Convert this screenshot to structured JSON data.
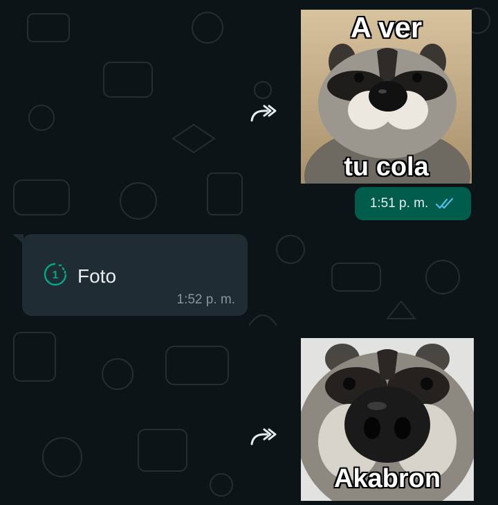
{
  "messages": {
    "sticker1": {
      "top_caption": "A ver",
      "bottom_caption": "tu cola",
      "time": "1:51 p. m."
    },
    "received": {
      "label": "Foto",
      "time": "1:52 p. m.",
      "view_once_number": "1"
    },
    "sticker2": {
      "caption": "Akabron"
    }
  },
  "colors": {
    "background": "#0d1418",
    "outgoing_bubble": "#005c4b",
    "incoming_bubble": "#202c33",
    "read_ticks": "#53bdeb",
    "view_once_green": "#00a884"
  },
  "icons": [
    "forward-icon",
    "double-check-icon",
    "view-once-icon"
  ]
}
